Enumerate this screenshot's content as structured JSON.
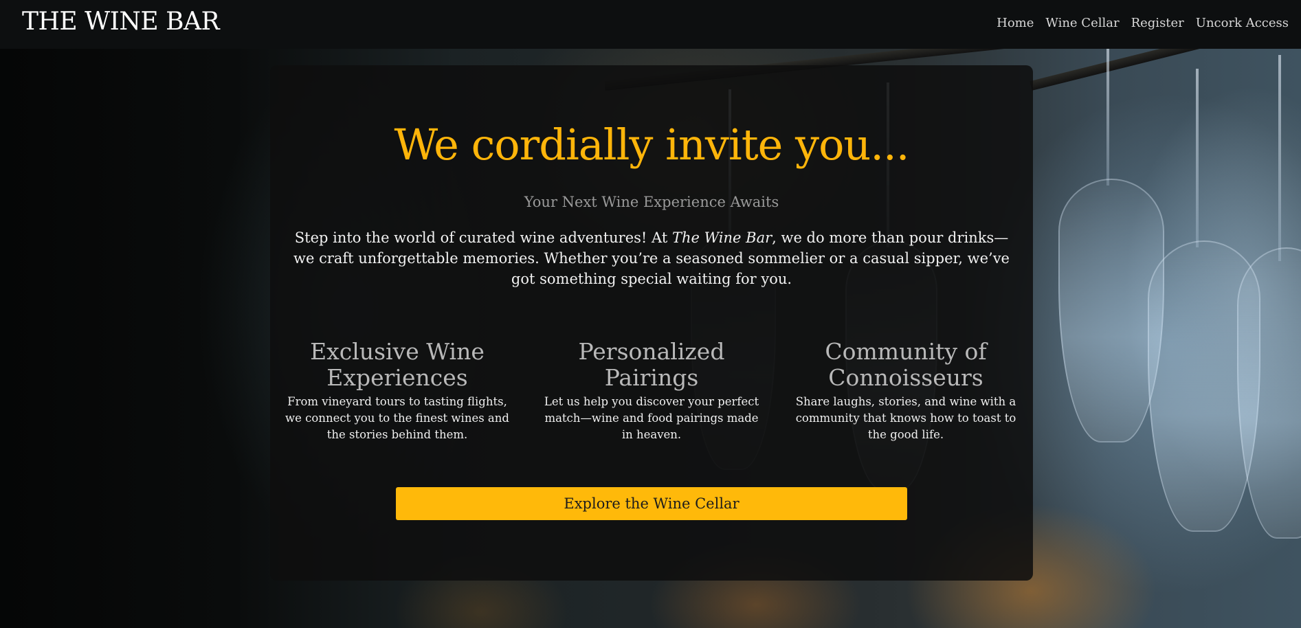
{
  "navbar": {
    "brand": "THE WINE BAR",
    "links": [
      "Home",
      "Wine Cellar",
      "Register",
      "Uncork Access"
    ]
  },
  "hero": {
    "headline": "We cordially invite you...",
    "subheading": "Your Next Wine Experience Awaits",
    "intro_before": "Step into the world of curated wine adventures! At ",
    "intro_brand": "The Wine Bar",
    "intro_after": ", we do more than pour drinks—we craft unforgettable memories. Whether you’re a seasoned sommelier or a casual sipper, we’ve got something special waiting for you."
  },
  "features": [
    {
      "title": "Exclusive Wine Experiences",
      "text": "From vineyard tours to tasting flights, we connect you to the finest wines and the stories behind them."
    },
    {
      "title": "Personalized Pairings",
      "text": "Let us help you discover your perfect match—wine and food pairings made in heaven."
    },
    {
      "title": "Community of Connoisseurs",
      "text": "Share laughs, stories, and wine with a community that knows how to toast to the good life."
    }
  ],
  "cta": {
    "label": "Explore the Wine Cellar"
  },
  "colors": {
    "accent": "#ffb50a",
    "button": "#ffb90a",
    "navbar": "#0d0f10",
    "card": "rgba(14,14,14,0.86)"
  }
}
